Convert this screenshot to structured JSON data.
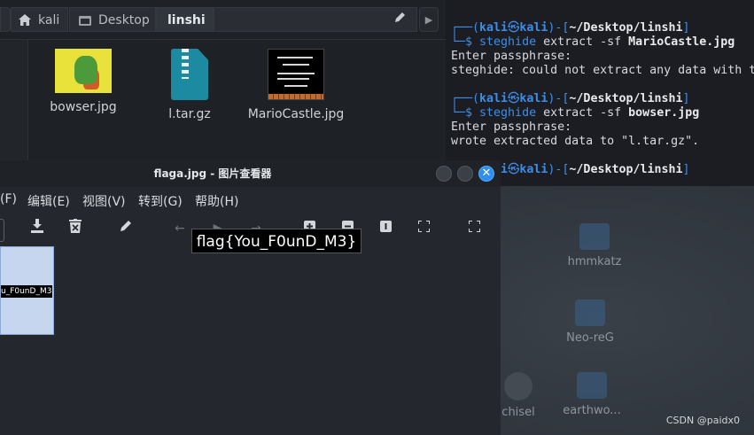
{
  "file_manager": {
    "breadcrumb": [
      "kali",
      "Desktop",
      "linshi"
    ],
    "files": [
      {
        "name": "bowser.jpg",
        "type": "image"
      },
      {
        "name": "l.tar.gz",
        "type": "archive"
      },
      {
        "name": "MarioCastle.jpg",
        "type": "image"
      }
    ]
  },
  "terminal": {
    "prompt_user": "kali",
    "prompt_at": "㉿",
    "prompt_host": "kali",
    "prompt_path": "~/Desktop/linshi",
    "lines": [
      {
        "cmd": "steghide",
        "args": "extract -sf",
        "file": "MarioCastle.jpg"
      },
      {
        "out": "Enter passphrase:"
      },
      {
        "out": "steghide: could not extract any data with t"
      },
      {
        "cmd": "steghide",
        "args": "extract -sf",
        "file": "bowser.jpg"
      },
      {
        "out": "Enter passphrase:"
      },
      {
        "out": "wrote extracted data to \"l.tar.gz\"."
      }
    ]
  },
  "viewer": {
    "title": "flaga.jpg - 图片查看器",
    "menu": [
      "(F)",
      "编辑(E)",
      "视图(V)",
      "转到(G)",
      "帮助(H)"
    ],
    "thumbnail_text": "u_F0unD_M3}",
    "image_text": "flag{You_F0unD_M3}"
  },
  "desktop": {
    "icons": [
      "hmmkatz",
      "Neo-reG",
      "chisel",
      "earthwo..."
    ]
  },
  "watermark": "CSDN @paidx0",
  "colors": {
    "accent": "#2f8ef0",
    "prompt_blue": "#3b8eea"
  }
}
